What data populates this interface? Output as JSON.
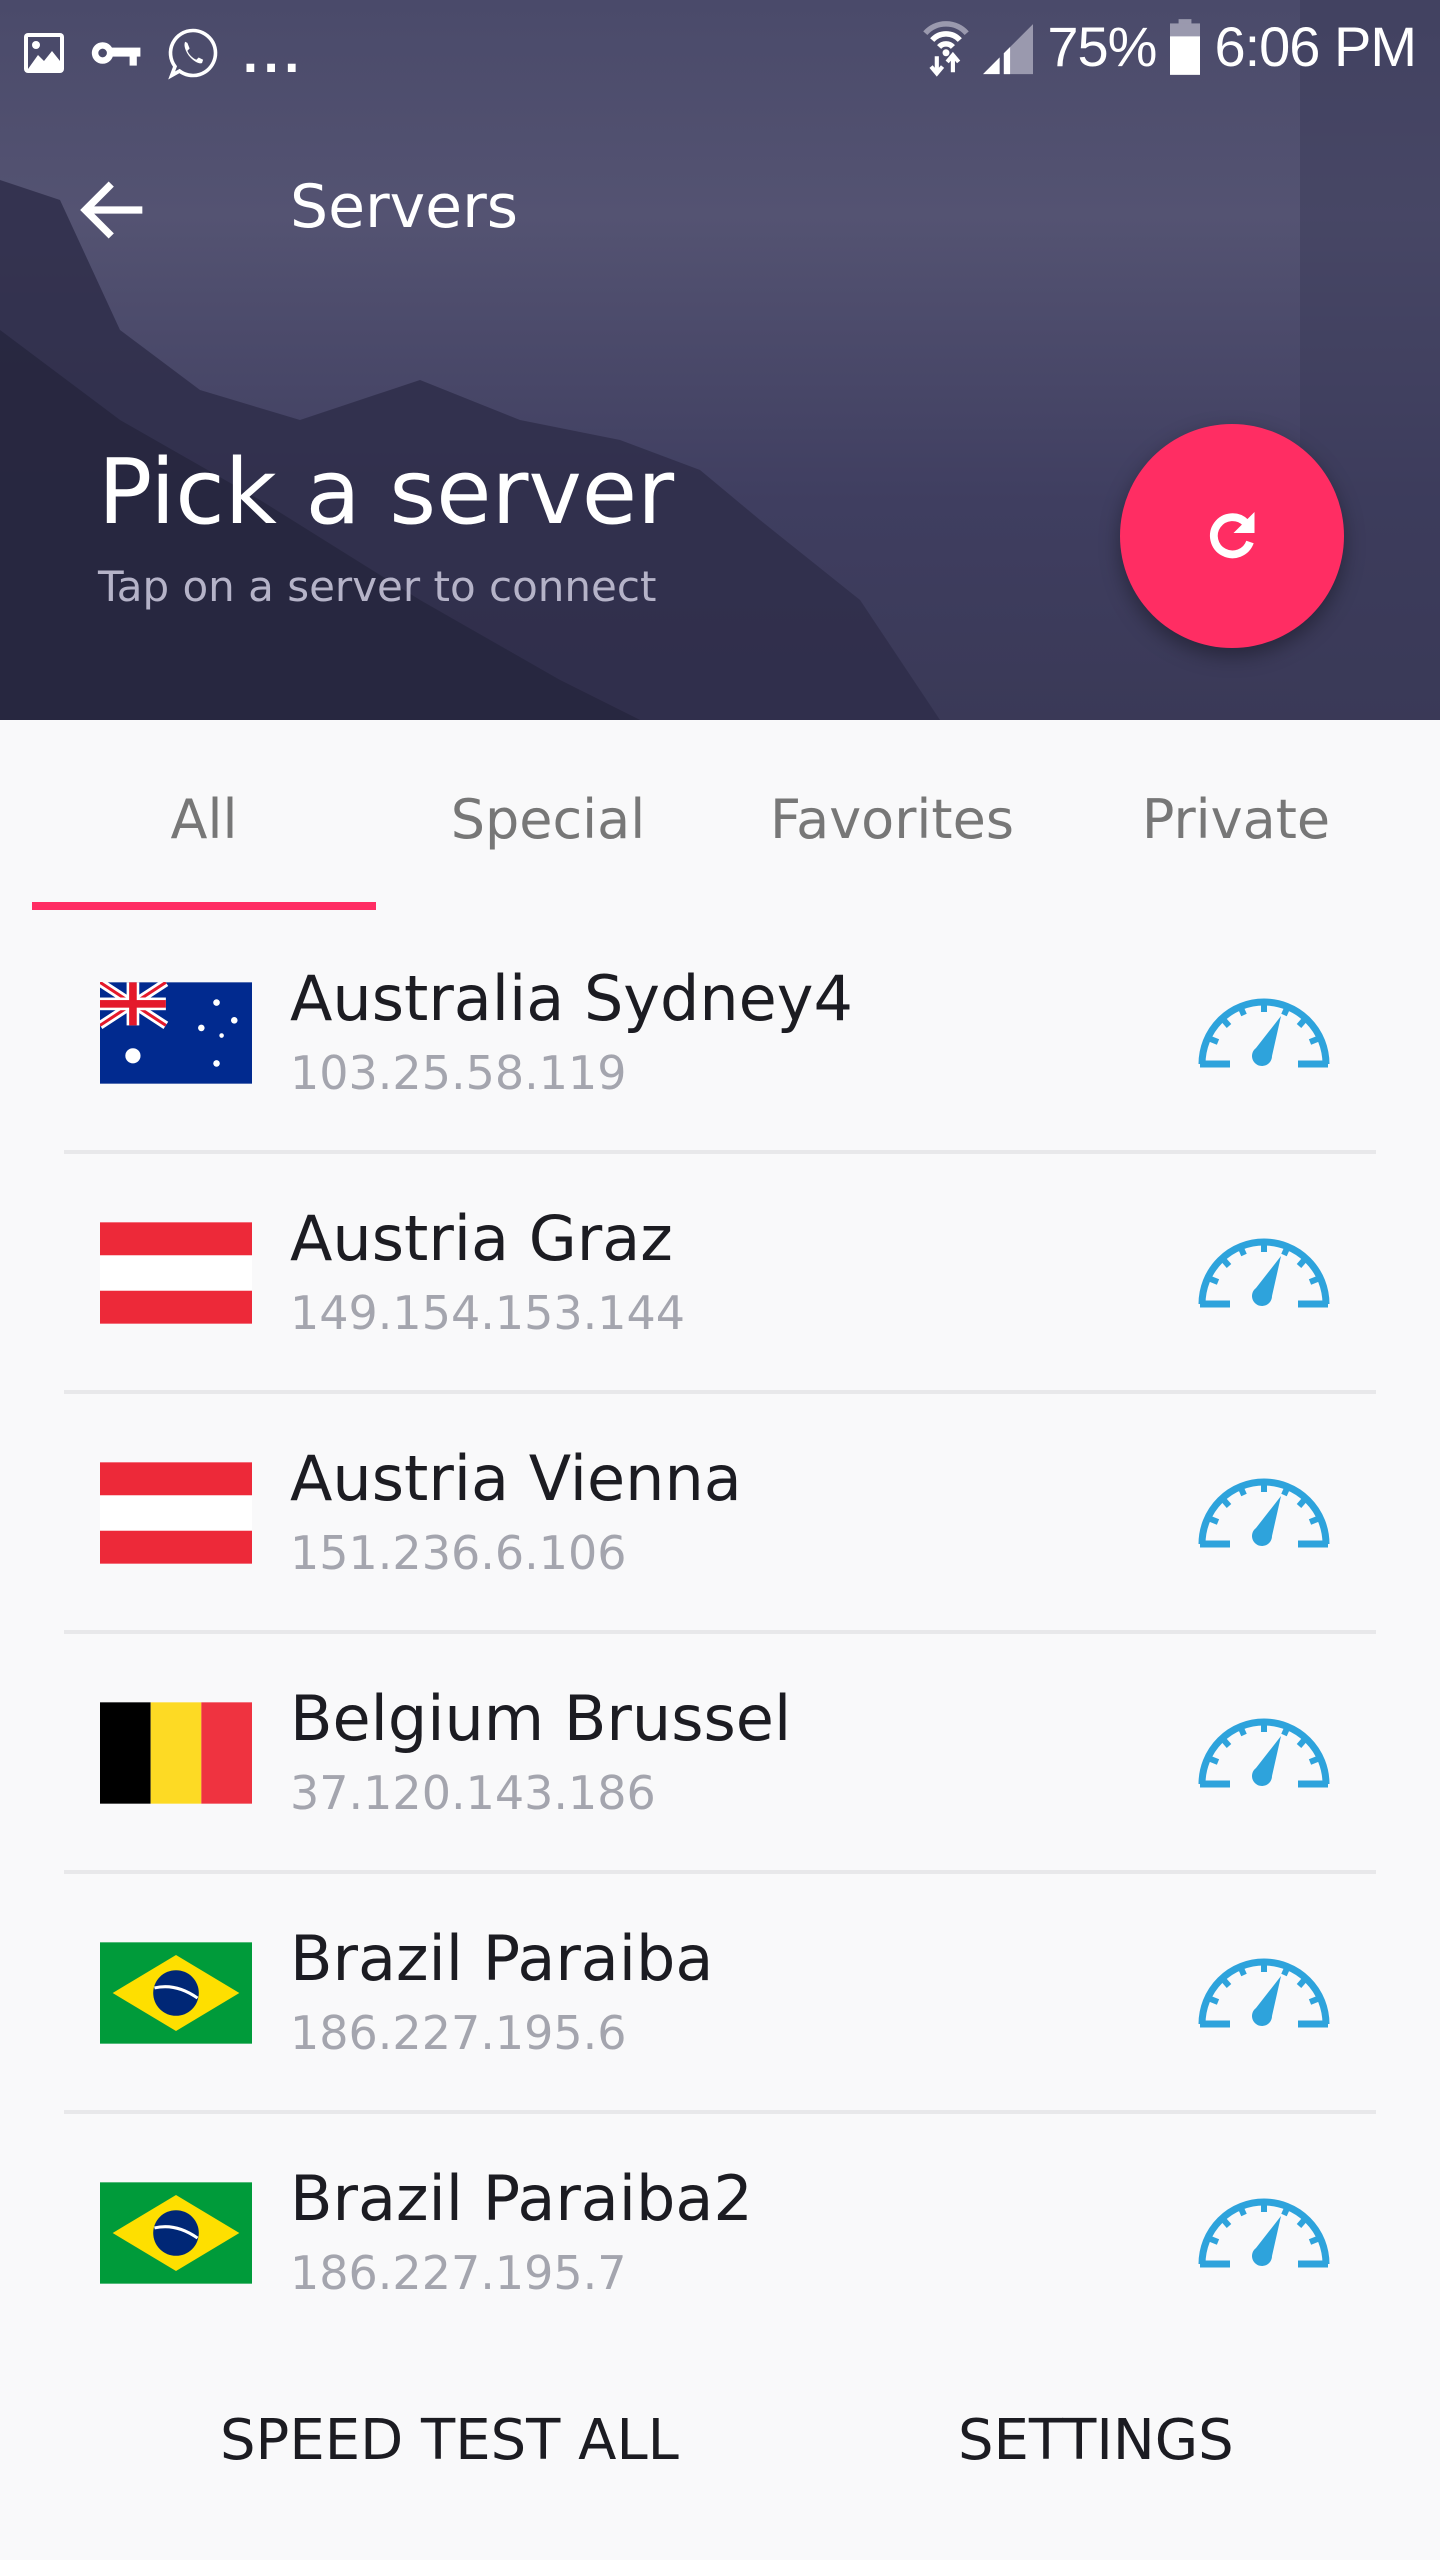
{
  "status_bar": {
    "notification_icons": [
      "gallery-icon",
      "vpn-key-icon",
      "whatsapp-icon"
    ],
    "more_indicator": "...",
    "battery_percent": "75%",
    "time": "6:06 PM"
  },
  "header": {
    "title": "Servers",
    "heading": "Pick a server",
    "subheading": "Tap on a server to connect",
    "refresh_icon": "refresh-icon",
    "accent_color": "#ff2d63"
  },
  "tabs": [
    {
      "label": "All",
      "active": true
    },
    {
      "label": "Special",
      "active": false
    },
    {
      "label": "Favorites",
      "active": false
    },
    {
      "label": "Private",
      "active": false
    }
  ],
  "servers": [
    {
      "name": "Australia Sydney4",
      "ip": "103.25.58.119",
      "flag": "australia"
    },
    {
      "name": "Austria Graz",
      "ip": "149.154.153.144",
      "flag": "austria"
    },
    {
      "name": "Austria Vienna",
      "ip": "151.236.6.106",
      "flag": "austria"
    },
    {
      "name": "Belgium Brussel",
      "ip": "37.120.143.186",
      "flag": "belgium"
    },
    {
      "name": "Brazil Paraiba",
      "ip": "186.227.195.6",
      "flag": "brazil"
    },
    {
      "name": "Brazil Paraiba2",
      "ip": "186.227.195.7",
      "flag": "brazil"
    }
  ],
  "footer": {
    "speed_test_all": "SPEED TEST ALL",
    "settings": "SETTINGS"
  },
  "colors": {
    "gauge": "#2ea3dc",
    "tab_active_indicator": "#ff2d63"
  }
}
